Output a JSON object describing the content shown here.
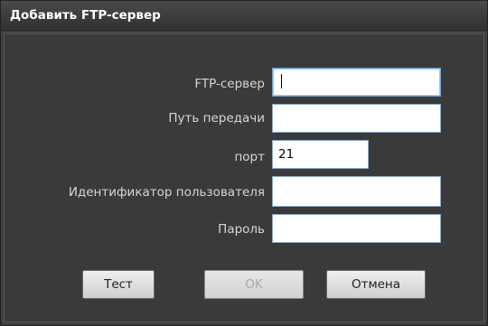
{
  "dialog": {
    "title": "Добавить FTP-сервер"
  },
  "form": {
    "fields": [
      {
        "label": "FTP-сервер",
        "value": ""
      },
      {
        "label": "Путь передачи",
        "value": ""
      },
      {
        "label": "порт",
        "value": "21"
      },
      {
        "label": "Идентификатор пользователя",
        "value": ""
      },
      {
        "label": "Пароль",
        "value": ""
      }
    ]
  },
  "buttons": {
    "test": "Тест",
    "ok": "OK",
    "cancel": "Отмена"
  },
  "colors": {
    "dialog_bg": "#3e3e3e",
    "label_text": "#d6d6d6",
    "field_border": "#8aa9c8"
  }
}
